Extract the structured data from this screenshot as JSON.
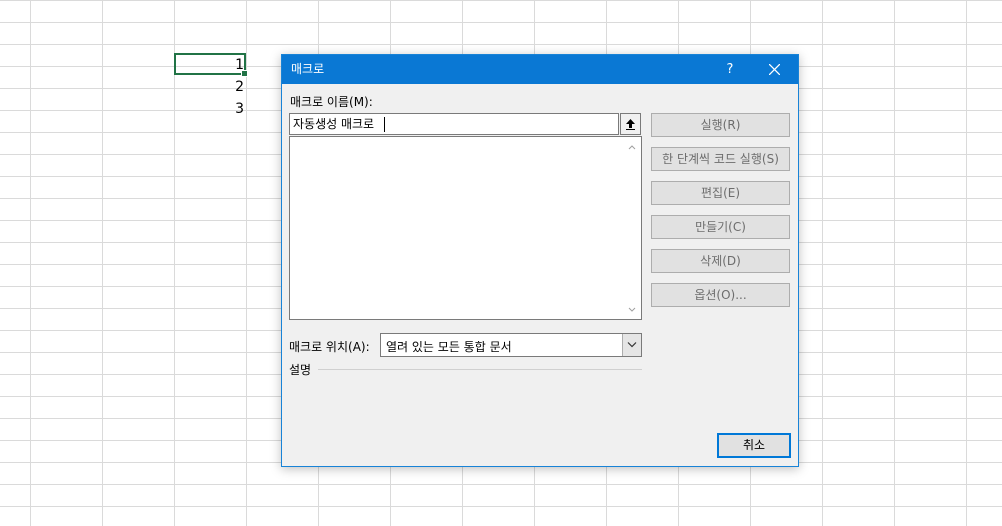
{
  "spreadsheet": {
    "cells": [
      "1",
      "2",
      "3"
    ]
  },
  "dialog": {
    "title": "매크로",
    "help": "?",
    "name_label": "매크로 이름(M):",
    "name_value": "자동생성 매크로",
    "buttons": {
      "run": "실행(R)",
      "step_into": "한 단계씩 코드 실행(S)",
      "edit": "편집(E)",
      "create": "만들기(C)",
      "delete": "삭제(D)",
      "options": "옵션(O)..."
    },
    "location_label": "매크로 위치(A):",
    "location_value": "열려 있는 모든 통합 문서",
    "description_label": "설명",
    "cancel": "취소"
  }
}
